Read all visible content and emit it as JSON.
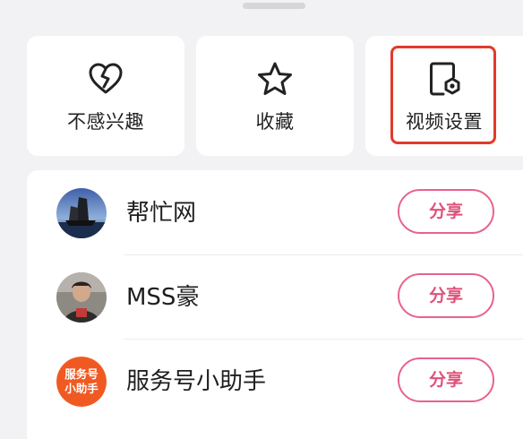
{
  "actions": [
    {
      "label": "不感兴趣",
      "icon": "broken-heart-icon"
    },
    {
      "label": "收藏",
      "icon": "star-icon"
    },
    {
      "label": "视频设置",
      "icon": "video-settings-icon"
    }
  ],
  "share_targets": [
    {
      "name": "帮忙网",
      "button": "分享",
      "avatar": "sea-boat-photo-avatar"
    },
    {
      "name": "MSS豪",
      "button": "分享",
      "avatar": "person-photo-avatar"
    },
    {
      "name": "服务号小助手",
      "button": "分享",
      "avatar": "service-badge-avatar",
      "avatar_text": [
        "服务号",
        "小助手"
      ]
    }
  ],
  "colors": {
    "share_accent": "#e0507a",
    "highlight": "#e23a2b",
    "badge": "#f05a22"
  }
}
